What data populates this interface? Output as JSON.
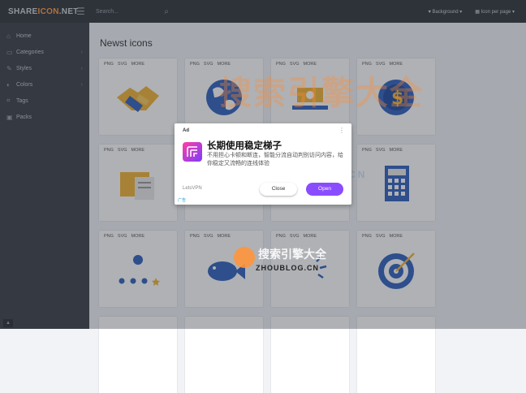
{
  "header": {
    "logo_a": "SHARE",
    "logo_b": "ICON",
    "logo_c": ".NET",
    "search_placeholder": "Search...",
    "background_label": "Background",
    "icons_per_page_label": "Icon per page"
  },
  "sidebar": {
    "items": [
      {
        "label": "Home",
        "chevron": false
      },
      {
        "label": "Categories",
        "chevron": true
      },
      {
        "label": "Styles",
        "chevron": true
      },
      {
        "label": "Colors",
        "chevron": true
      },
      {
        "label": "Tags",
        "chevron": false
      },
      {
        "label": "Packs",
        "chevron": false
      }
    ]
  },
  "main": {
    "title": "Newst icons",
    "links": [
      "PNG",
      "SVG",
      "MORE"
    ]
  },
  "ad": {
    "label": "Ad",
    "title": "长期使用稳定梯子",
    "description": "不用担心卡顿和断连，智能分流自动判别访问内容，给你稳定又流畅的连线体验",
    "brand": "LetsVPN",
    "close_label": "Close",
    "open_label": "Open",
    "corner_label": "广告"
  },
  "watermark": {
    "text_main": "搜索引擎大全",
    "text_en": "ZHOUBLOG.CN",
    "text_small": "搜索引擎大全",
    "text_small_en": "ZHOUBLOG.CN"
  },
  "colors": {
    "accent": "#ff9b3f",
    "open_button": "#8a4cff"
  }
}
